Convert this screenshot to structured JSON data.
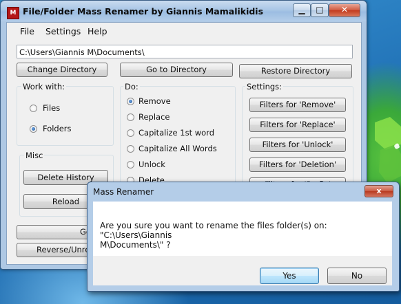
{
  "window": {
    "title": "File/Folder Mass Renamer by Giannis Mamalikidis",
    "icon": "app-logo-icon",
    "controls": [
      "minimize",
      "maximize",
      "close"
    ]
  },
  "menu": [
    "File",
    "Settings",
    "Help"
  ],
  "path": {
    "value": "C:\\Users\\Giannis M\\Documents\\"
  },
  "top_buttons": {
    "change_directory": "Change Directory",
    "go_to_directory": "Go to Directory",
    "restore_directory": "Restore Directory"
  },
  "work_with": {
    "label": "Work with:",
    "options": [
      "Files",
      "Folders"
    ],
    "selected": "Folders"
  },
  "misc": {
    "label": "Misc",
    "delete_history": "Delete History",
    "reload": "Reload"
  },
  "bottom_buttons": {
    "go": "Go",
    "reverse": "Reverse/Unren"
  },
  "do": {
    "label": "Do:",
    "options": [
      "Remove",
      "Replace",
      "Capitalize 1st word",
      "Capitalize All Words",
      "Unlock",
      "Delete"
    ],
    "selected": "Remove"
  },
  "settings": {
    "label": "Settings:",
    "buttons": [
      "Filters for 'Remove'",
      "Filters for 'Replace'",
      "Filters for 'Unlock'",
      "Filters for 'Deletion'",
      "Filters for 'Prefix'"
    ]
  },
  "dialog": {
    "title": "Mass Renamer",
    "close": "x",
    "message_line1": "Are you sure you want to rename the files folder(s) on: \"C:\\Users\\Giannis",
    "message_line2": "M\\Documents\\\" ?",
    "yes": "Yes",
    "no": "No"
  }
}
